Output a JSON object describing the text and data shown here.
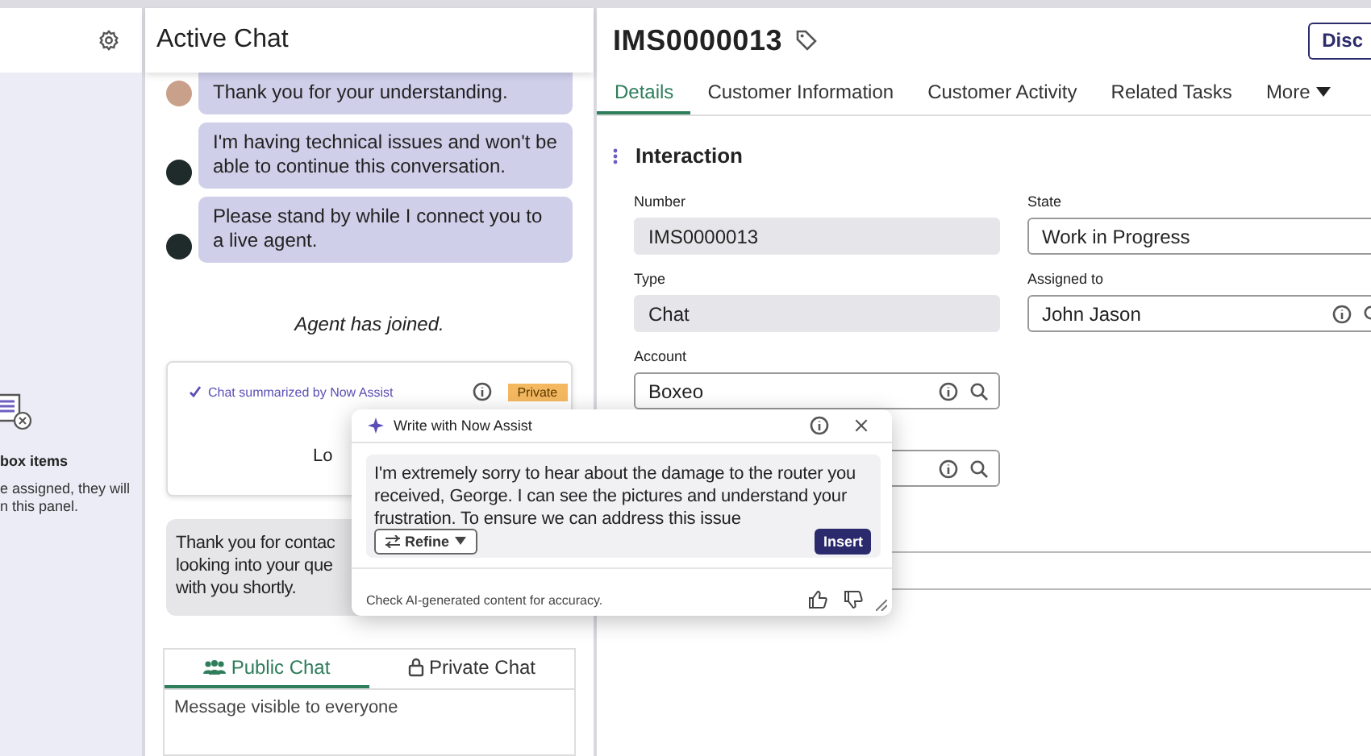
{
  "sidebar": {
    "empty_title": "box items",
    "empty_text": "e assigned, they will\nn this panel."
  },
  "chat": {
    "title": "Active Chat",
    "messages": [
      {
        "kind": "customer",
        "text": "Thank you for your understanding."
      },
      {
        "kind": "bot",
        "text": "I'm having technical issues and won't be able to continue this conversation."
      },
      {
        "kind": "bot",
        "text": "Please stand by while I connect you to a live agent."
      },
      {
        "kind": "system",
        "text": "Agent has joined."
      },
      {
        "kind": "summary",
        "label": "Chat summarized by Now Assist",
        "badge": "Private",
        "text": "Lo"
      },
      {
        "kind": "agent",
        "text": "Thank you for contac\nlooking into your que\nwith you shortly."
      }
    ],
    "composer": {
      "tabs": [
        {
          "label": "Public Chat",
          "selected": true
        },
        {
          "label": "Private Chat",
          "selected": false
        }
      ],
      "placeholder": "Message visible to everyone"
    }
  },
  "record": {
    "number": "IMS0000013",
    "action": "Disc",
    "tabs": [
      {
        "label": "Details",
        "selected": true,
        "kind": "tab"
      },
      {
        "label": "Customer Information",
        "selected": false,
        "kind": "tab"
      },
      {
        "label": "Customer Activity",
        "selected": false,
        "kind": "tab"
      },
      {
        "label": "Related Tasks",
        "selected": false,
        "kind": "tab"
      },
      {
        "label": "More",
        "selected": false,
        "kind": "menu"
      }
    ],
    "section": "Interaction",
    "columns": [
      [
        {
          "label": "Number",
          "value": "IMS0000013",
          "kind": "readonly"
        },
        {
          "label": "Type",
          "value": "Chat",
          "kind": "readonly"
        },
        {
          "label": "Account",
          "value": "Boxeo",
          "kind": "reference"
        },
        {
          "kind": "reference"
        }
      ],
      [
        {
          "label": "State",
          "value": "Work in Progress",
          "kind": "select"
        },
        {
          "label": "Assigned to",
          "value": "John Jason",
          "kind": "reference"
        }
      ]
    ],
    "notes": {
      "kind": "textarea"
    }
  },
  "assist_popup": {
    "title": "Write with Now Assist",
    "text": "I'm extremely sorry to hear about the damage to the router you received, George. I can see the pictures and understand your frustration. To ensure we can address this issue",
    "refine": "Refine",
    "insert": "Insert",
    "disclaimer": "Check AI-generated content for accuracy."
  }
}
